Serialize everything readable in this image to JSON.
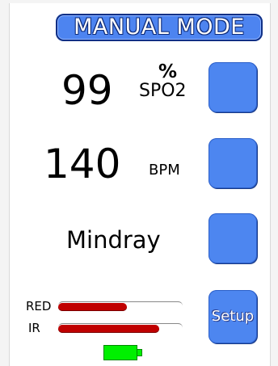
{
  "header": {
    "mode_label": "MANUAL MODE"
  },
  "readings": {
    "spo2": {
      "value": "99",
      "unit_top": "%",
      "unit_bottom": "SPO2"
    },
    "pulse": {
      "value": "140",
      "unit": "BPM"
    },
    "sensor": {
      "name": "Mindray"
    }
  },
  "signal_bars": [
    {
      "label": "RED",
      "level_fraction": 0.55,
      "color": "#c00000"
    },
    {
      "label": "IR",
      "level_fraction": 0.81,
      "color": "#c00000"
    }
  ],
  "buttons": {
    "setup_label": "Setup",
    "color": "#4d86f0"
  },
  "battery": {
    "color": "#00f000",
    "level_fraction": 1.0
  }
}
